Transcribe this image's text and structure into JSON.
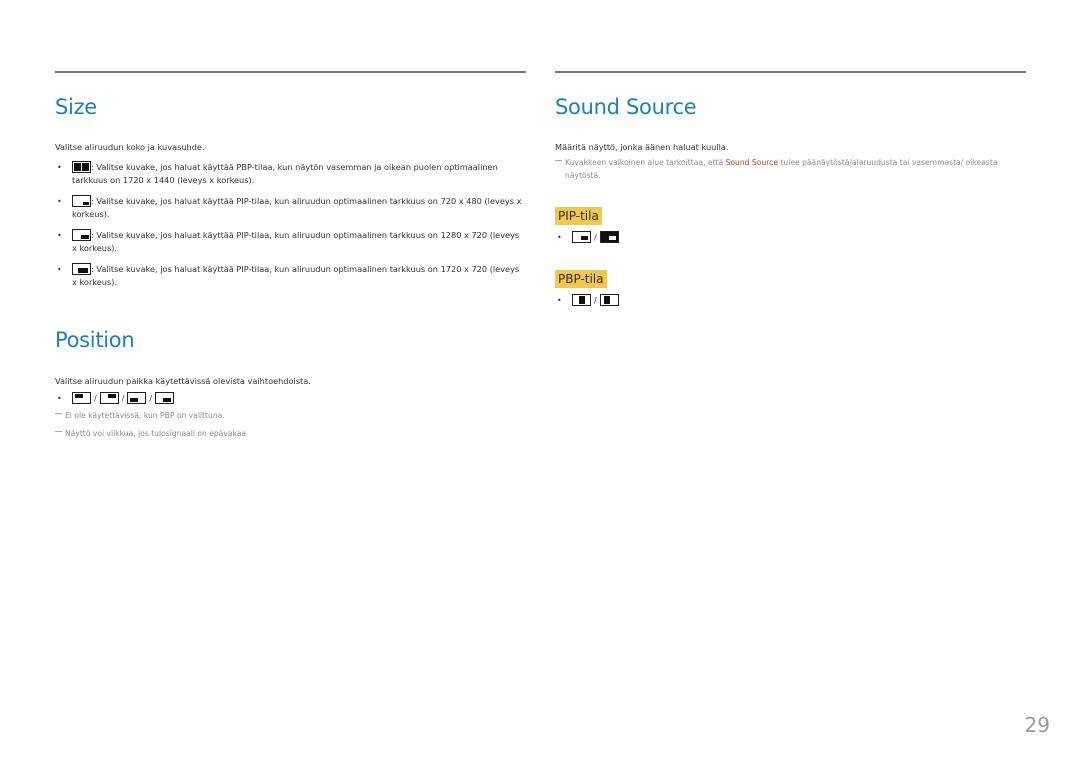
{
  "size": {
    "title": "Size",
    "intro": "Valitse aliruudun koko ja kuvasuhde.",
    "items": [
      {
        "icon": "pbp-split-icon",
        "text": ": Valitse kuvake, jos haluat käyttää PBP-tilaa, kun näytön vasemman ja oikean puolen optimaalinen tarkkuus on 1720 x 1440 (leveys x korkeus)."
      },
      {
        "icon": "pip-small-icon",
        "text": ": Valitse kuvake, jos haluat käyttää PIP-tilaa, kun aliruudun optimaalinen tarkkuus on 720 x 480 (leveys x korkeus)."
      },
      {
        "icon": "pip-medium-icon",
        "text": ": Valitse kuvake, jos haluat käyttää PIP-tilaa, kun aliruudun optimaalinen tarkkuus on 1280 x 720 (leveys x korkeus)."
      },
      {
        "icon": "pip-large-icon",
        "text": ": Valitse kuvake, jos haluat käyttää PIP-tilaa, kun aliruudun optimaalinen tarkkuus on 1720 x 720 (leveys x korkeus)."
      }
    ]
  },
  "position": {
    "title": "Position",
    "intro": "Valitse aliruudun paikka käytettävissä olevista vaihtoehdoista.",
    "icons": [
      "top-left-icon",
      "top-right-icon",
      "bottom-left-icon",
      "bottom-right-icon"
    ],
    "separator": "/",
    "notes": [
      "Ei ole käytettävissä, kun PBP on valittuna.",
      "Näyttö voi vilkkua, jos tulosignaali on epävakaa"
    ]
  },
  "sound_source": {
    "title": "Sound Source",
    "intro": "Määritä näyttö, jonka äänen haluat kuulla.",
    "note_before": "Kuvakkeen valkoinen alue tarkoittaa, että ",
    "note_highlight": "Sound Source",
    "note_after": " tulee päänäytöstä/alaruudusta tai vasemmasta/ oikeasta näytöstä.",
    "highlight_color": "#c0431a",
    "pip_label": "PIP-tila",
    "pbp_label": "PBP-tila",
    "separator": "/"
  },
  "page_number": "29",
  "colors": {
    "heading": "#1b7fc1",
    "tag_bg": "#f1c84b"
  }
}
